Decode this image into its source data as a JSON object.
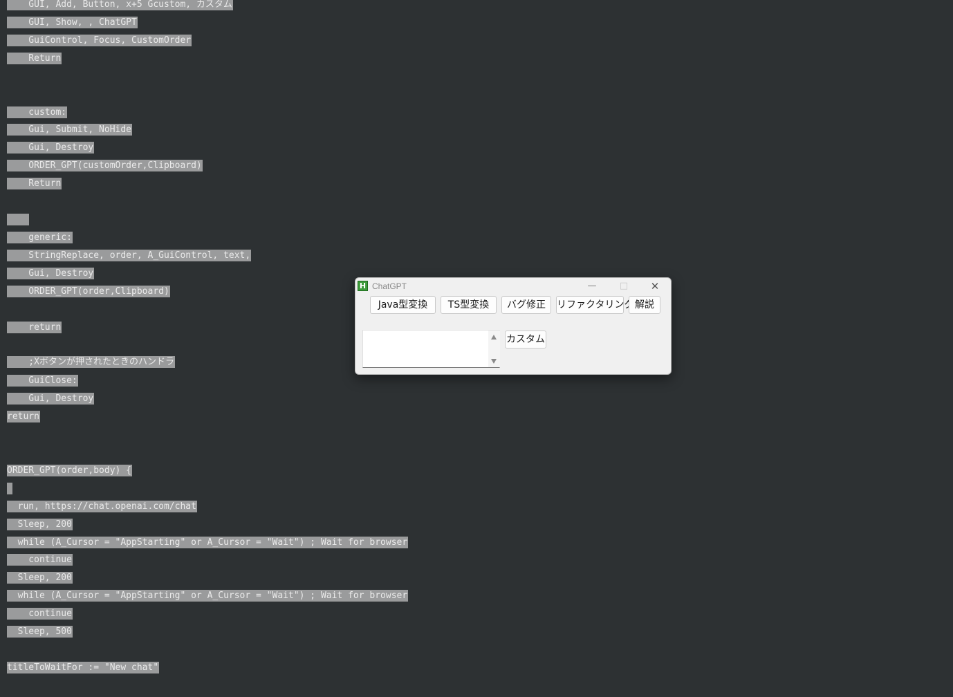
{
  "code_lines": [
    "    GUI, Add, Button, x+5 Gcustom, カスタム",
    "    GUI, Show, , ChatGPT",
    "    GuiControl, Focus, CustomOrder",
    "    Return",
    "    custom:",
    "    Gui, Submit, NoHide",
    "    Gui, Destroy",
    "    ORDER_GPT(customOrder,Clipboard)",
    "    Return",
    "    ",
    "    generic:",
    "    StringReplace, order, A_GuiControl, text,",
    "    Gui, Destroy",
    "    ORDER_GPT(order,Clipboard)",
    "    return",
    "    ;Xボタンが押されたときのハンドラ",
    "    GuiClose:",
    "    Gui, Destroy",
    "return",
    "ORDER_GPT(order,body) {",
    "",
    "  run, https://chat.openai.com/chat",
    "  Sleep, 200",
    "  while (A_Cursor = \"AppStarting\" or A_Cursor = \"Wait\") ; Wait for browser",
    "    continue",
    "  Sleep, 200",
    "  while (A_Cursor = \"AppStarting\" or A_Cursor = \"Wait\") ; Wait for browser",
    "    continue",
    "  Sleep, 500",
    "titleToWaitFor := \"New chat\""
  ],
  "dialog": {
    "title": "ChatGPT",
    "icon": "autohotkey-h-icon",
    "icon_glyph": "H",
    "minimize_glyph": "—",
    "maximize_glyph": "□",
    "close_glyph": "✕",
    "buttons": {
      "java": "Java型変換",
      "ts": "TS型変換",
      "bug": "バグ修正",
      "refactor": "リファクタリング",
      "explain": "解説",
      "custom": "カスタム"
    },
    "custom_order_value": ""
  },
  "colors": {
    "editor_background": "#2d3133",
    "selection_highlight": "#9a9b9c",
    "dialog_background": "#f0f0f0"
  }
}
